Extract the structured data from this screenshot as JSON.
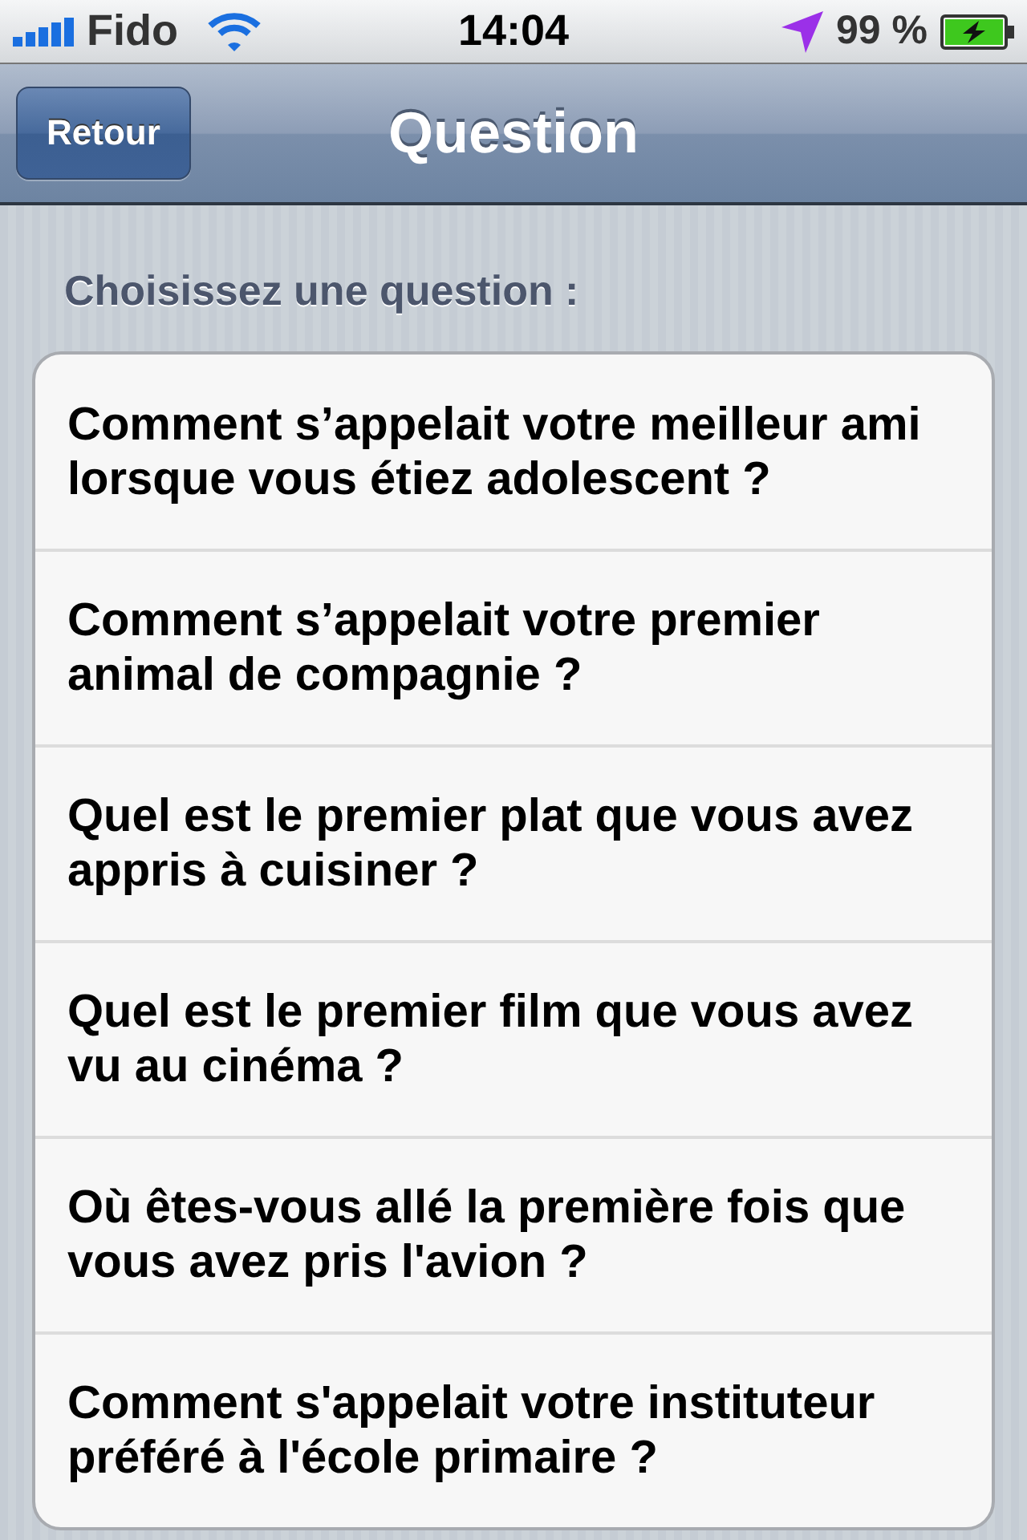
{
  "status_bar": {
    "carrier": "Fido",
    "time": "14:04",
    "battery": "99 %"
  },
  "nav_bar": {
    "back_button": "Retour",
    "title": "Question"
  },
  "section_header": "Choisissez une question :",
  "questions": [
    {
      "text": "Comment s’appelait votre meilleur ami lorsque vous étiez adolescent ?"
    },
    {
      "text": "Comment s’appelait votre premier animal de compagnie ?"
    },
    {
      "text": "Quel est le premier plat que vous avez appris à cuisiner ?"
    },
    {
      "text": "Quel est le premier film que vous avez vu au cinéma ?"
    },
    {
      "text": "Où êtes-vous allé la première fois que vous avez pris l'avion ?"
    },
    {
      "text": "Comment s'appelait votre instituteur préféré à l'école primaire ?"
    }
  ]
}
